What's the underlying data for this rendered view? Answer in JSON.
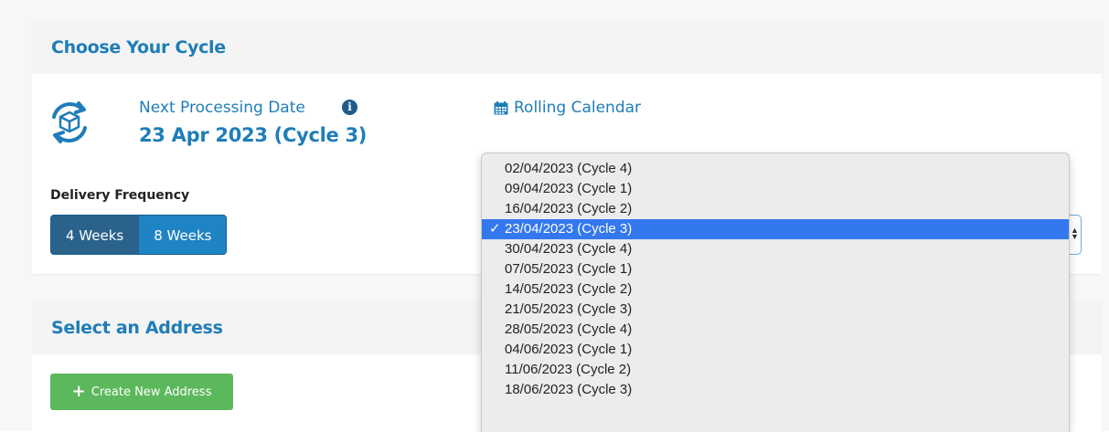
{
  "cycle_panel": {
    "title": "Choose Your Cycle",
    "next_processing_label": "Next Processing Date",
    "next_processing_value": "23 Apr 2023 (Cycle 3)",
    "rolling_calendar_link": "Rolling Calendar",
    "delivery_frequency_label": "Delivery Frequency",
    "frequency_options": [
      {
        "label": "4 Weeks",
        "active": true
      },
      {
        "label": "8 Weeks",
        "active": false
      }
    ]
  },
  "address_panel": {
    "title": "Select an Address",
    "create_button": "Create New Address"
  },
  "date_dropdown": {
    "selected_index": 3,
    "check_mark": "✓",
    "options": [
      "02/04/2023 (Cycle 4)",
      "09/04/2023 (Cycle 1)",
      "16/04/2023 (Cycle 2)",
      "23/04/2023 (Cycle 3)",
      "30/04/2023 (Cycle 4)",
      "07/05/2023 (Cycle 1)",
      "14/05/2023 (Cycle 2)",
      "21/05/2023 (Cycle 3)",
      "28/05/2023 (Cycle 4)",
      "04/06/2023 (Cycle 1)",
      "11/06/2023 (Cycle 2)",
      "18/06/2023 (Cycle 3)"
    ]
  },
  "colors": {
    "accent_blue": "#1f7db8",
    "active_toggle": "#2a628c",
    "inactive_toggle": "#1f84c4",
    "create_green": "#5cb85c",
    "selection_blue": "#3478f0"
  },
  "icons": {
    "cycle": "cycle-box-icon",
    "info": "info-icon",
    "calendar": "calendar-icon",
    "plus": "plus-icon"
  }
}
